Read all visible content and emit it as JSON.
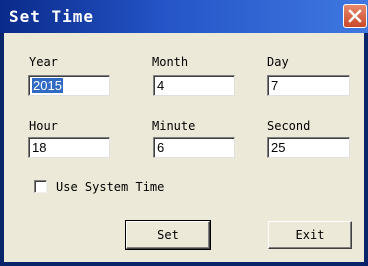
{
  "window": {
    "title": "Set Time",
    "close_icon": "close-icon",
    "colors": {
      "title_start": "#0a2a8a",
      "title_end": "#3f78e0",
      "close": "#d55a3a",
      "selection": "#316ac5",
      "face": "#ece9d8"
    }
  },
  "fields": {
    "year": {
      "label": "Year",
      "value": "2015",
      "selected": true
    },
    "month": {
      "label": "Month",
      "value": "4"
    },
    "day": {
      "label": "Day",
      "value": "7"
    },
    "hour": {
      "label": "Hour",
      "value": "18"
    },
    "minute": {
      "label": "Minute",
      "value": "6"
    },
    "second": {
      "label": "Second",
      "value": "25"
    }
  },
  "use_system_time": {
    "label": "Use System Time",
    "checked": false
  },
  "buttons": {
    "set": "Set",
    "exit": "Exit"
  }
}
